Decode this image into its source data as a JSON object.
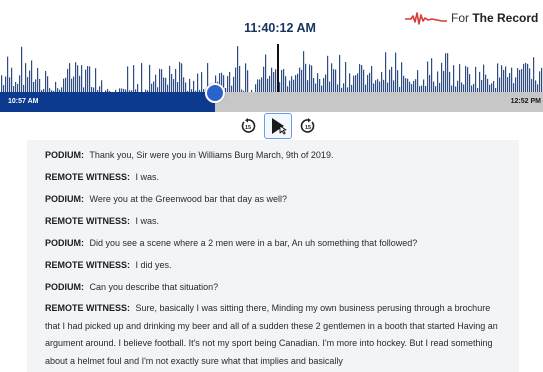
{
  "header": {
    "current_time": "11:40:12 AM",
    "brand_prefix": "For",
    "brand_name": "The Record",
    "brand_color": "#d93a3a",
    "logo_icon": "heartbeat-waveform-icon"
  },
  "player": {
    "start_time": "10:57 AM",
    "end_time": "12:52 PM",
    "progress_fraction": 0.396,
    "track_color": "#c7c7c7",
    "fill_color": "#0c3a8f",
    "waveform_color": "#2f4d80",
    "buttons": {
      "rewind_icon": "rewind-15-icon",
      "play_icon": "play-icon",
      "forward_icon": "forward-15-icon"
    }
  },
  "transcript": [
    {
      "speaker": "PODIUM:",
      "text": "Thank you, Sir were you in Williams Burg March, 9th of 2019."
    },
    {
      "speaker": "REMOTE WITNESS:",
      "text": "I was."
    },
    {
      "speaker": "PODIUM:",
      "text": "Were you at the Greenwood bar that day as well?"
    },
    {
      "speaker": "REMOTE WITNESS:",
      "text": "I was."
    },
    {
      "speaker": "PODIUM:",
      "text": "Did you see a scene where a 2 men were in a bar, An uh something that followed?"
    },
    {
      "speaker": "REMOTE WITNESS:",
      "text": "I did yes."
    },
    {
      "speaker": "PODIUM:",
      "text": "Can you describe that situation?"
    },
    {
      "speaker": "REMOTE WITNESS:",
      "text": "Sure, basically I was sitting there, Minding my own business perusing through a brochure that I had picked up and drinking my beer and all of a sudden these 2 gentlemen in a booth that started Having an argument around. I believe football. It's not my sport being Canadian. I'm more into hockey. But I read something about a helmet foul and I'm not exactly sure what that implies and basically"
    }
  ]
}
